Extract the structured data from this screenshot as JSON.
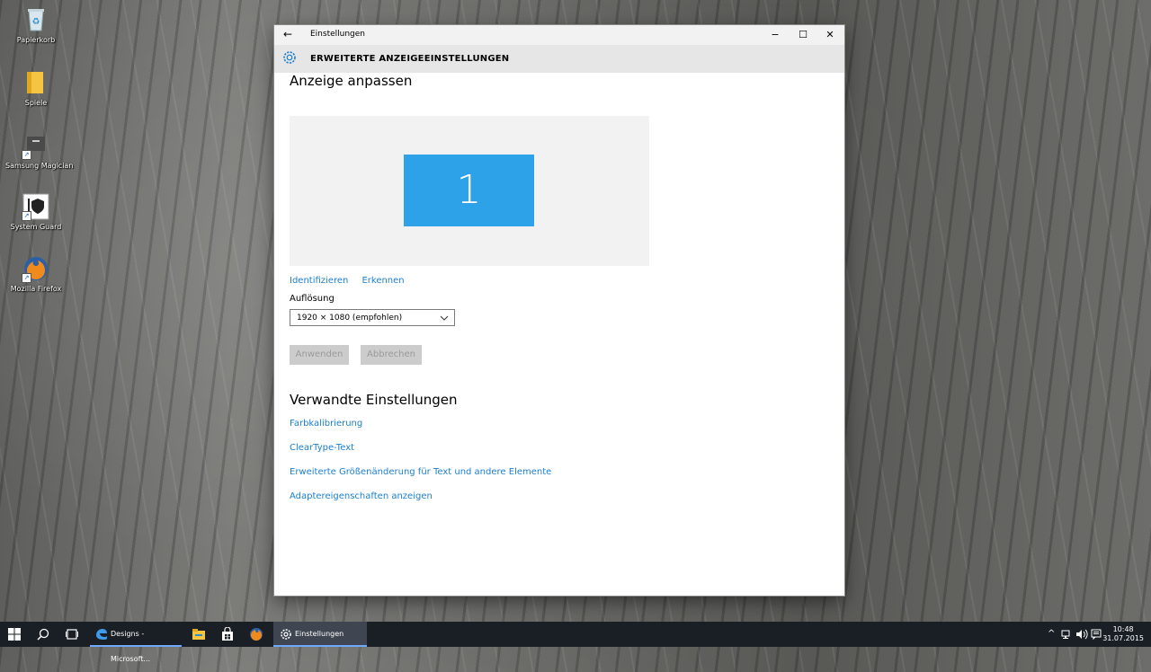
{
  "desktop": {
    "icons": [
      {
        "label": "Papierkorb",
        "icon": "recycle-bin-icon"
      },
      {
        "label": "Spiele",
        "icon": "folder-icon"
      },
      {
        "label": "Samsung Magician",
        "icon": "samsung-magician-icon"
      },
      {
        "label": "System Guard",
        "icon": "system-guard-icon"
      },
      {
        "label": "Mozilla Firefox",
        "icon": "firefox-icon"
      }
    ]
  },
  "window": {
    "title": "Einstellungen",
    "header": "ERWEITERTE ANZEIGEEINSTELLUNGEN",
    "controls": {
      "minimize": "−",
      "maximize": "☐",
      "close": "✕"
    },
    "back_glyph": "←",
    "section1": {
      "title": "Anzeige anpassen",
      "monitor_number": "1",
      "identify": "Identifizieren",
      "detect": "Erkennen",
      "resolution_label": "Auflösung",
      "resolution_value": "1920 × 1080 (empfohlen)",
      "apply": "Anwenden",
      "cancel": "Abbrechen"
    },
    "section2": {
      "title": "Verwandte Einstellungen",
      "links": [
        "Farbkalibrierung",
        "ClearType-Text",
        "Erweiterte Größenänderung für Text und andere Elemente",
        "Adaptereigenschaften anzeigen"
      ]
    }
  },
  "taskbar": {
    "edge_label": "Designs - Microsoft...",
    "settings_label": "Einstellungen",
    "tray_icons": [
      "chevron-up-icon",
      "network-icon",
      "volume-icon",
      "notifications-icon"
    ],
    "time": "10:48",
    "date": "31.07.2015"
  },
  "colors": {
    "accent": "#2ea2e8",
    "link": "#1c7fd1",
    "taskbar": "#1a1f26"
  }
}
